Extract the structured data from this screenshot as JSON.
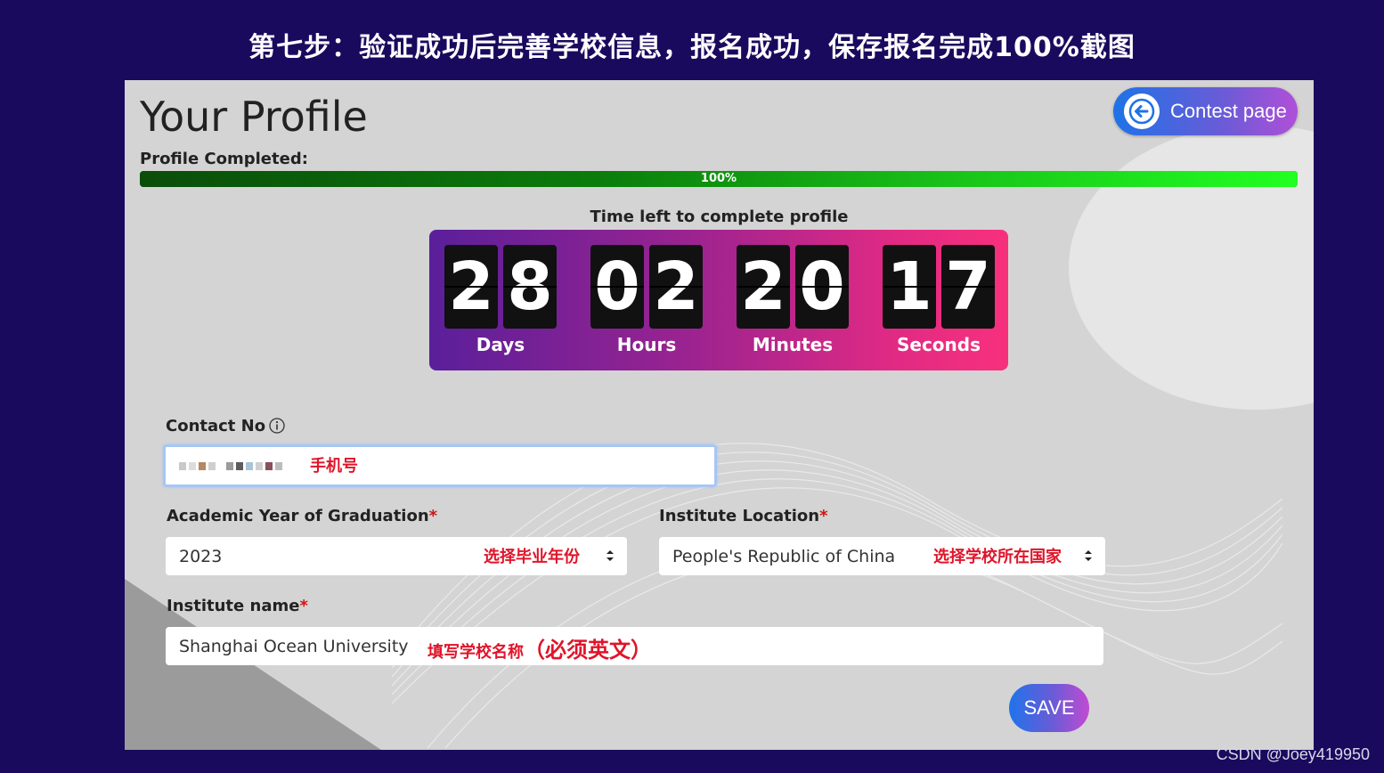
{
  "slide": {
    "title": "第七步：验证成功后完善学校信息，报名成功，保存报名完成100%截图",
    "watermark": "CSDN @Joey419950"
  },
  "header": {
    "title": "Your Profile",
    "contest_button_label": "Contest page"
  },
  "profile_progress": {
    "label": "Profile Completed:",
    "percent_text": "100%",
    "value": 100
  },
  "countdown": {
    "label": "Time left to complete profile",
    "days": {
      "d1": "2",
      "d2": "8",
      "label": "Days"
    },
    "hours": {
      "d1": "0",
      "d2": "2",
      "label": "Hours"
    },
    "minutes": {
      "d1": "2",
      "d2": "0",
      "label": "Minutes"
    },
    "seconds": {
      "d1": "1",
      "d2": "7",
      "label": "Seconds"
    }
  },
  "form": {
    "contact": {
      "label": "Contact No",
      "annotation": "手机号"
    },
    "graduation_year": {
      "label": "Academic Year of Graduation",
      "required_mark": "*",
      "value": "2023",
      "annotation": "选择毕业年份"
    },
    "institute_location": {
      "label": "Institute Location",
      "required_mark": "*",
      "value": "People's Republic of China",
      "annotation": "选择学校所在国家"
    },
    "institute_name": {
      "label": "Institute name",
      "required_mark": "*",
      "value": "Shanghai Ocean University",
      "annotation_main": "填写学校名称",
      "annotation_emph": "（必须英文）"
    },
    "save_label": "SAVE"
  },
  "colors": {
    "page_bg": "#1a0a5e",
    "panel_bg": "#d4d4d4",
    "annotation_red": "#e0142a",
    "progress_green": "#21ff21"
  }
}
